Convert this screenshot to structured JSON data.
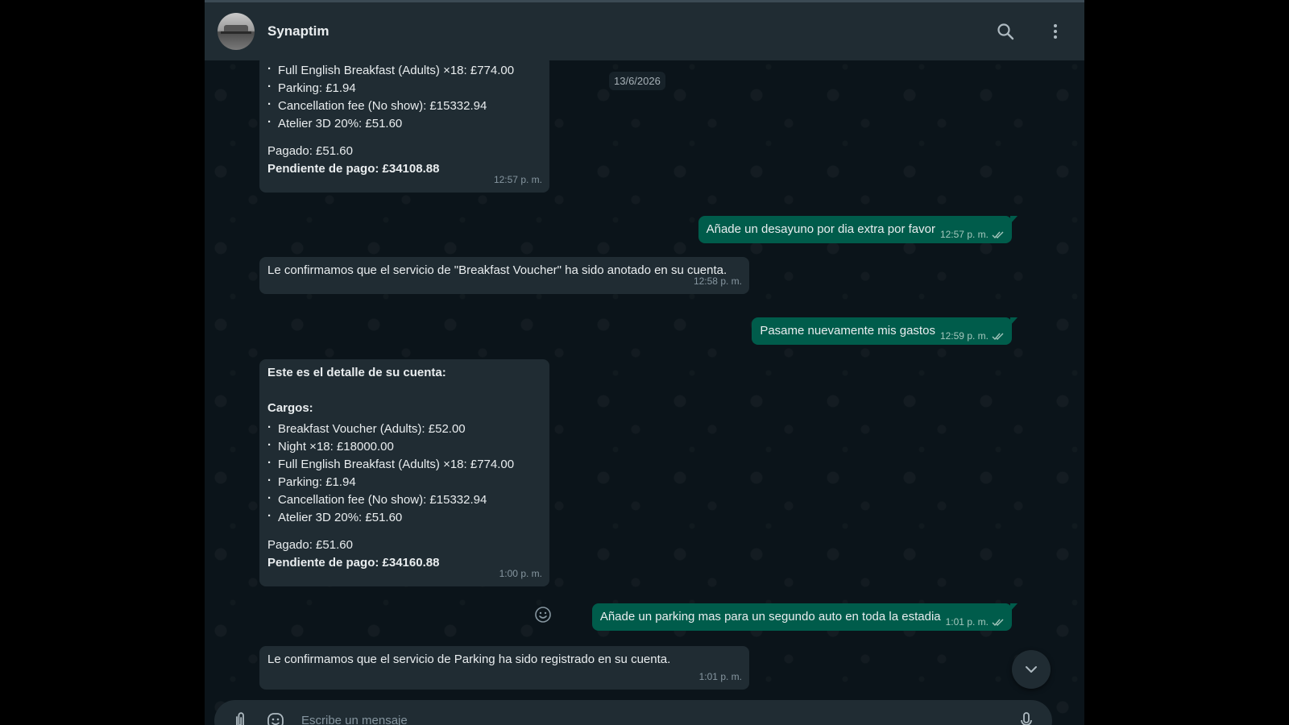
{
  "header": {
    "contact_name": "Synaptim",
    "icons": {
      "search": "search-icon",
      "menu": "more-vertical-icon"
    }
  },
  "date_chip": "13/6/2026",
  "messages": [
    {
      "id": "m1",
      "direction": "incoming",
      "items": [
        "Full English Breakfast (Adults) ×18: £774.00",
        "Parking: £1.94",
        "Cancellation fee (No show): £15332.94",
        "Atelier 3D 20%: £51.60"
      ],
      "paid": "Pagado: £51.60",
      "pending": "Pendiente de pago: £34108.88",
      "time": "12:57 p. m."
    },
    {
      "id": "m2",
      "direction": "outgoing",
      "text": "Añade un desayuno por dia extra por favor",
      "time": "12:57 p. m.",
      "status": "read"
    },
    {
      "id": "m3",
      "direction": "incoming",
      "text": "Le confirmamos que el servicio de \"Breakfast Voucher\" ha sido anotado en su cuenta.",
      "time": "12:58 p. m."
    },
    {
      "id": "m4",
      "direction": "outgoing",
      "text": "Pasame nuevamente mis gastos",
      "time": "12:59 p. m.",
      "status": "read"
    },
    {
      "id": "m5",
      "direction": "incoming",
      "heading": "Este es el detalle de su cuenta:",
      "charges_label": "Cargos:",
      "items": [
        "Breakfast Voucher (Adults): £52.00",
        "Night ×18: £18000.00",
        "Full English Breakfast (Adults) ×18: £774.00",
        "Parking: £1.94",
        "Cancellation fee (No show): £15332.94",
        "Atelier 3D 20%: £51.60"
      ],
      "paid": "Pagado: £51.60",
      "pending": "Pendiente de pago: £34160.88",
      "time": "1:00 p. m."
    },
    {
      "id": "m6",
      "direction": "outgoing",
      "text": "Añade un parking mas para un segundo auto en toda la estadia",
      "time": "1:01 p. m.",
      "status": "read"
    },
    {
      "id": "m7",
      "direction": "incoming",
      "text": "Le confirmamos que el servicio de Parking ha sido registrado en su cuenta.",
      "time": "1:01 p. m."
    }
  ],
  "composer": {
    "placeholder": "Escribe un mensaje"
  },
  "colors": {
    "app_bg": "#0b141a",
    "header_bg": "#202c33",
    "incoming_bubble": "#202c33",
    "outgoing_bubble": "#005c4b",
    "text_primary": "#e9edef",
    "text_secondary": "#8696a0",
    "read_ticks": "#a5c7bd"
  }
}
